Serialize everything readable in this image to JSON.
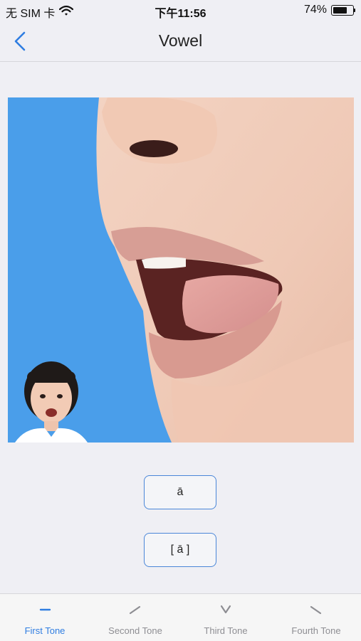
{
  "status_bar": {
    "carrier": "无 SIM 卡",
    "time": "下午11:56",
    "battery_percent": "74%",
    "battery_level": 0.74
  },
  "nav": {
    "title": "Vowel",
    "back_icon": "chevron-left-icon"
  },
  "media": {
    "main_image": "mouth-closeup-open-vowel",
    "pip_image": "teacher-face"
  },
  "buttons": {
    "pinyin": "ā",
    "ipa": "[ ā ]"
  },
  "tabs": [
    {
      "label": "First Tone",
      "icon": "flat-tone-mark-icon",
      "active": true
    },
    {
      "label": "Second Tone",
      "icon": "rising-tone-mark-icon",
      "active": false
    },
    {
      "label": "Third Tone",
      "icon": "dipping-tone-mark-icon",
      "active": false
    },
    {
      "label": "Fourth Tone",
      "icon": "falling-tone-mark-icon",
      "active": false
    }
  ],
  "colors": {
    "accent": "#2f7de1",
    "inactive": "#8e8e93",
    "backdrop_blue": "#4a9eea"
  }
}
